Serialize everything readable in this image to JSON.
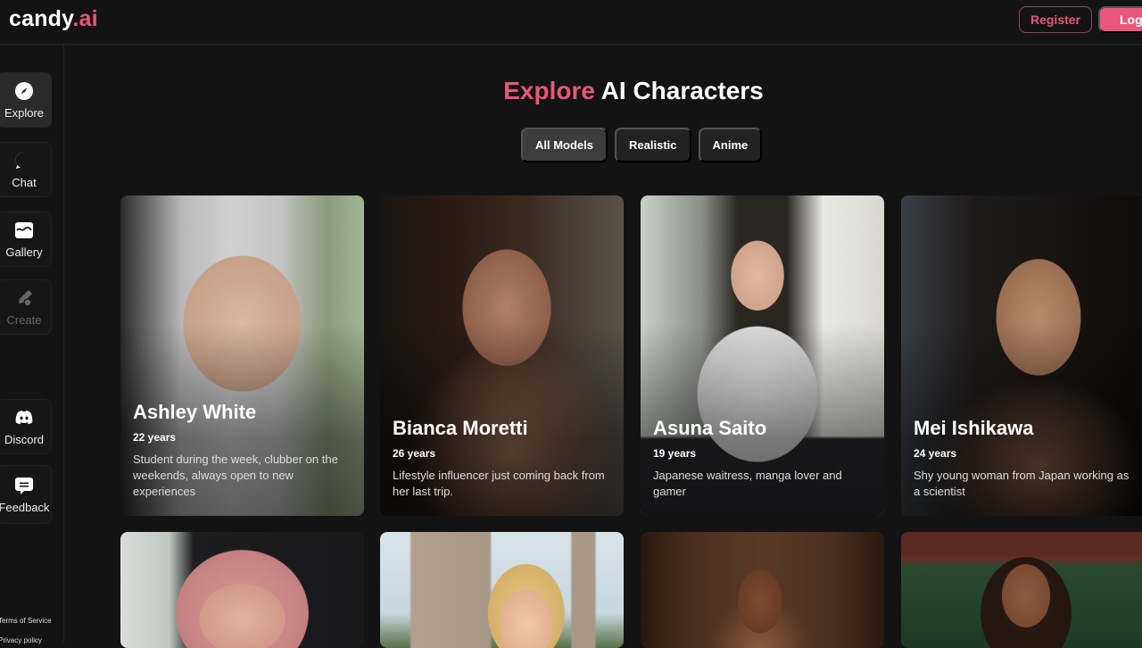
{
  "header": {
    "logo_main": "candy",
    "logo_accent": ".ai",
    "register_label": "Register",
    "login_label": "Login"
  },
  "sidebar": {
    "items": [
      {
        "label": "Explore",
        "icon": "compass-icon",
        "active": true
      },
      {
        "label": "Chat",
        "icon": "chat-bubble-icon"
      },
      {
        "label": "Gallery",
        "icon": "image-icon"
      },
      {
        "label": "Create",
        "icon": "brush-icon",
        "disabled": true
      },
      {
        "label": "Discord",
        "icon": "discord-icon"
      },
      {
        "label": "Feedback",
        "icon": "feedback-icon"
      }
    ],
    "footer_links": [
      "Terms of Service",
      "Privacy policy"
    ]
  },
  "main": {
    "title_accent": "Explore",
    "title_rest": "AI Characters",
    "filters": [
      {
        "label": "All Models",
        "active": true
      },
      {
        "label": "Realistic"
      },
      {
        "label": "Anime"
      }
    ],
    "characters": [
      {
        "name": "Ashley White",
        "age": "22 years",
        "description": "Student during the week, clubber on the weekends, always open to new experiences"
      },
      {
        "name": "Bianca Moretti",
        "age": "26 years",
        "description": "Lifestyle influencer just coming back from her last trip."
      },
      {
        "name": "Asuna Saito",
        "age": "19 years",
        "description": "Japanese waitress, manga lover and gamer"
      },
      {
        "name": "Mei Ishikawa",
        "age": "24 years",
        "description": "Shy young woman from Japan working as a scientist"
      }
    ]
  },
  "colors": {
    "accent": "#e8577a",
    "background": "#131313",
    "surface": "#222222",
    "surface_active": "#3d3d3d"
  }
}
